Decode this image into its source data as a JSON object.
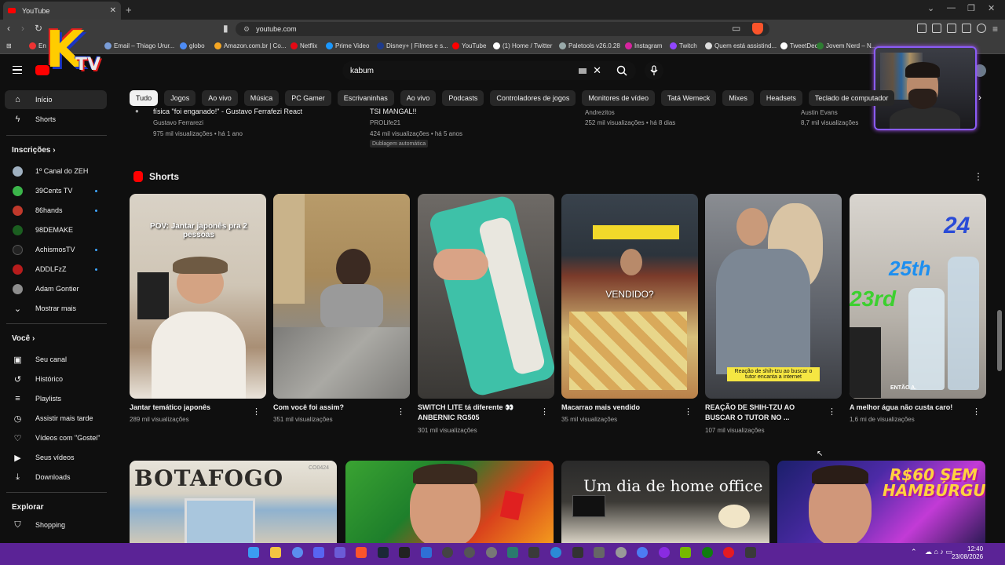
{
  "browser": {
    "tab_title": "YouTube",
    "address": "youtube.com",
    "bookmarks": [
      "En",
      "Email – Thiago Urur...",
      "globo",
      "Amazon.com.br | Co...",
      "Netflix",
      "Prime Video",
      "Disney+ | Filmes e s...",
      "YouTube",
      "(1) Home / Twitter",
      "Paletools v26.0.28",
      "Instagram",
      "Twitch",
      "Quem está assistind...",
      "TweetDeck",
      "Jovem Nerd – N..."
    ]
  },
  "overlay": {
    "logo_k": "K",
    "logo_tv": "TV"
  },
  "youtube": {
    "search_value": "kabum",
    "chips": [
      "Tudo",
      "Jogos",
      "Ao vivo",
      "Música",
      "PC Gamer",
      "Escrivaninhas",
      "Ao vivo",
      "Podcasts",
      "Controladores de jogos",
      "Monitores de vídeo",
      "Tatá Wemeck",
      "Mixes",
      "Headsets",
      "Teclado de computador"
    ],
    "sidebar": {
      "main": [
        "Início",
        "Shorts"
      ],
      "subscriptions_header": "Inscrições",
      "subscriptions": [
        "1º Canal do ZEH",
        "39Cents TV",
        "86hands",
        "98DEMAKE",
        "AchismosTV",
        "ADDLFzZ",
        "Adam Gontier",
        "Mostrar mais"
      ],
      "you_header": "Você",
      "you": [
        "Seu canal",
        "Histórico",
        "Playlists",
        "Assistir mais tarde",
        "Vídeos com \"Gostei\"",
        "Seus vídeos",
        "Downloads"
      ],
      "explore_header": "Explorar",
      "explore": [
        "Shopping"
      ]
    },
    "previous_row": [
      {
        "title": "física \"foi enganado!\" - Gustavo Ferrafezi React",
        "channel": "Gustavo Ferrarezi",
        "meta": "975 mil visualizações • há 1 ano"
      },
      {
        "title": "TSI MANGAL!!",
        "channel": "PROLife21",
        "meta": "424 mil visualizações • há 5 anos",
        "badge": "Dublagem automática"
      },
      {
        "title": "",
        "channel": "Andrezitos",
        "meta": "252 mil visualizações • há 8 dias"
      },
      {
        "title": "",
        "channel": "Austin Evans",
        "meta": "8,7 mil visualizações"
      }
    ],
    "shorts_title": "Shorts",
    "shorts": [
      {
        "overlay": "POV: Jantar japonês pra 2 pessoas",
        "title": "Jantar temático japonês",
        "views": "289 mil visualizações"
      },
      {
        "overlay": "",
        "title": "Com você foi assim?",
        "views": "351 mil visualizações"
      },
      {
        "overlay": "",
        "title": "SWITCH LITE tá diferente 👀 ANBERNIC RG505",
        "views": "301 mil visualizações"
      },
      {
        "overlay": "VENDIDO?",
        "title": "Macarrao mais vendido",
        "views": "35 mil visualizações"
      },
      {
        "overlay": "Reação de shih-tzu ao buscar o tutor encanta a internet",
        "title": "REAÇÃO DE SHIH-TZU AO BUSCAR O TUTOR NO ...",
        "views": "107 mil visualizações"
      },
      {
        "overlay": "ENTÃO A.",
        "overlay_big": [
          "24",
          "25th",
          "23rd"
        ],
        "title": "A melhor água não custa caro!",
        "views": "1,6 mi de visualizações"
      }
    ],
    "next_thumbs": [
      {
        "text": "BOTAFOGO",
        "sub": "CO0424"
      },
      {
        "text": ""
      },
      {
        "text": "Um dia de home office"
      },
      {
        "text": "R$60 SEM HAMBÚRGUER"
      }
    ]
  },
  "taskbar": {
    "time": "12:40",
    "date": "23/08/2026"
  }
}
